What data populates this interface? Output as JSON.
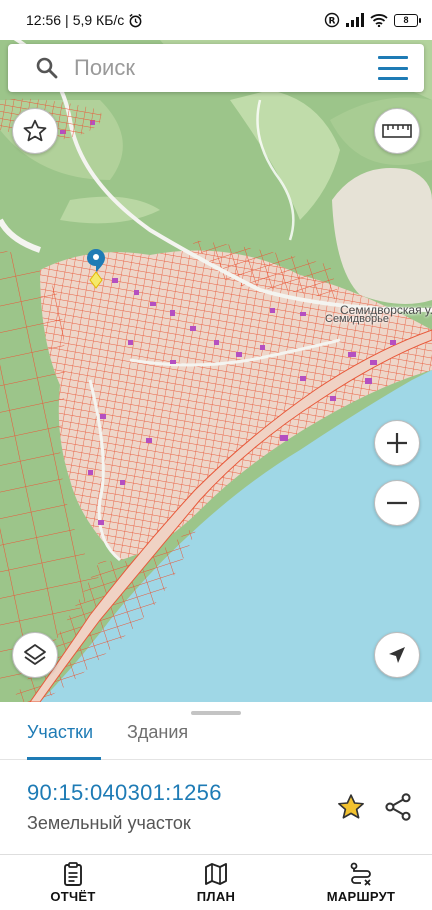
{
  "status_bar": {
    "time": "12:56",
    "network_speed": "5,9 КБ/с",
    "battery_level": "8"
  },
  "search": {
    "placeholder": "Поиск"
  },
  "map": {
    "labels": {
      "street": "Семидворская ули",
      "village": "Семидворье"
    }
  },
  "sheet": {
    "tabs": [
      {
        "label": "Участки",
        "active": true
      },
      {
        "label": "Здания",
        "active": false
      }
    ],
    "parcel": {
      "cadastral_number": "90:15:040301:1256",
      "type": "Земельный участок"
    }
  },
  "bottom_nav": {
    "items": [
      {
        "label": "ОТЧЁТ",
        "icon": "report-icon"
      },
      {
        "label": "ПЛАН",
        "icon": "map-plan-icon"
      },
      {
        "label": "МАРШРУТ",
        "icon": "route-icon"
      }
    ]
  },
  "colors": {
    "accent": "#1e7bb5",
    "parcel_outline": "#e8593a",
    "sea": "#9fd7e6",
    "terrain": "#9cc58a",
    "favorite": "#f2c230"
  }
}
